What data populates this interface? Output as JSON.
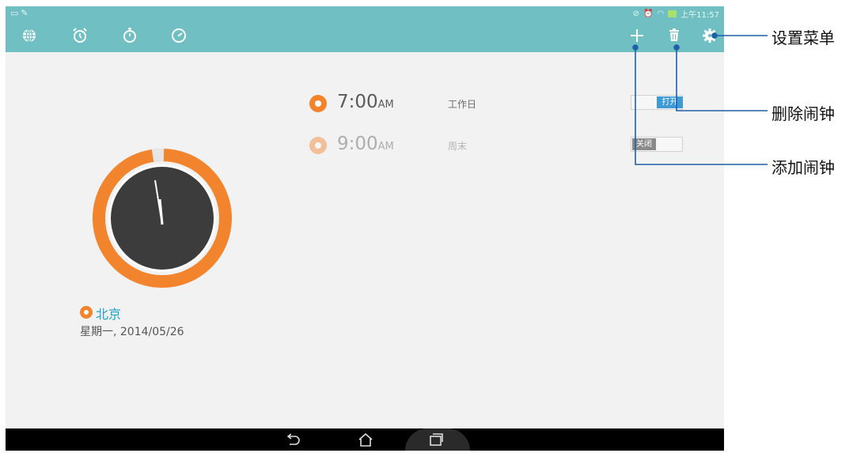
{
  "statusbar": {
    "left_icons": [
      "screen-icon",
      "edit-icon"
    ],
    "right_icons": [
      "mute-icon",
      "alarm-icon",
      "wifi-icon",
      "battery-charging-icon"
    ],
    "time": "上午11:57"
  },
  "tabs": [
    {
      "name": "world-clock",
      "icon": "globe-icon"
    },
    {
      "name": "alarm",
      "icon": "alarm-clock-icon",
      "selected": true
    },
    {
      "name": "stopwatch",
      "icon": "stopwatch-icon"
    },
    {
      "name": "timer",
      "icon": "timer-icon"
    }
  ],
  "actions": [
    {
      "name": "add",
      "icon": "plus-icon"
    },
    {
      "name": "delete",
      "icon": "trash-icon"
    },
    {
      "name": "settings",
      "icon": "gear-icon"
    }
  ],
  "alarms": [
    {
      "time": "7:00",
      "ampm": "AM",
      "label": "工作日",
      "toggle": "打开",
      "enabled": true
    },
    {
      "time": "9:00",
      "ampm": "AM",
      "label": "周末",
      "toggle": "关闭",
      "enabled": false
    }
  ],
  "clock": {
    "city": "北京",
    "date": "星期一, 2014/05/26"
  },
  "callouts": {
    "settings": "设置菜单",
    "delete": "删除闹钟",
    "add": "添加闹钟"
  },
  "colors": {
    "accent_bar": "#6fbfc3",
    "orange": "#f2842d",
    "toggle_on": "#3e9bd6",
    "toggle_off": "#8a8a8a",
    "city_text": "#23a2c4"
  }
}
